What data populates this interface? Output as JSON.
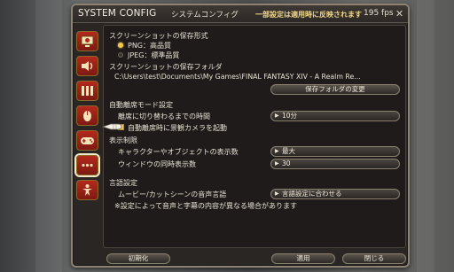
{
  "window": {
    "title_en": "SYSTEM CONFIG",
    "title_jp": "システムコンフィグ",
    "notice": "一部設定は適用時に反映されます",
    "fps": "195 fps"
  },
  "sidebar": {
    "categories": [
      {
        "icon": "display-icon"
      },
      {
        "icon": "sound-icon"
      },
      {
        "icon": "graphics-icon"
      },
      {
        "icon": "mouse-icon"
      },
      {
        "icon": "gamepad-icon"
      },
      {
        "icon": "other-settings-icon",
        "active": true
      },
      {
        "icon": "character-icon"
      }
    ]
  },
  "screenshot": {
    "format_header": "スクリーンショットの保存形式",
    "options": [
      "PNG：高品質",
      "JPEG：標準品質"
    ],
    "selected": "PNG：高品質",
    "folder_header": "スクリーンショットの保存フォルダ",
    "folder_path": "C:\\Users\\test\\Documents\\My Games\\FINAL FANTASY XIV - A Realm Re...",
    "change_folder_button": "保存フォルダの変更"
  },
  "afk": {
    "header": "自動離席モード設定",
    "time_label": "離席に切り替わるまでの時間",
    "time_value": "10分",
    "camera_label": "自動離席時に景観カメラを起動",
    "camera_checked": true
  },
  "display_limit": {
    "header": "表示制限",
    "chars_label": "キャラクターやオブジェクトの表示数",
    "chars_value": "最大",
    "windows_label": "ウィンドウの同時表示数",
    "windows_value": "30"
  },
  "language": {
    "header": "言語設定",
    "cutscene_label": "ムービー/カットシーンの音声言語",
    "cutscene_value": "言語設定に合わせる",
    "note": "※設定によって音声と字幕の内容が異なる場合があります"
  },
  "footer": {
    "reset": "初期化",
    "apply": "適用",
    "close": "閉じる"
  },
  "colors": {
    "accent_gold": "#f2c84b",
    "notice_text": "#f1d98a",
    "category_red": "#b3291c"
  }
}
